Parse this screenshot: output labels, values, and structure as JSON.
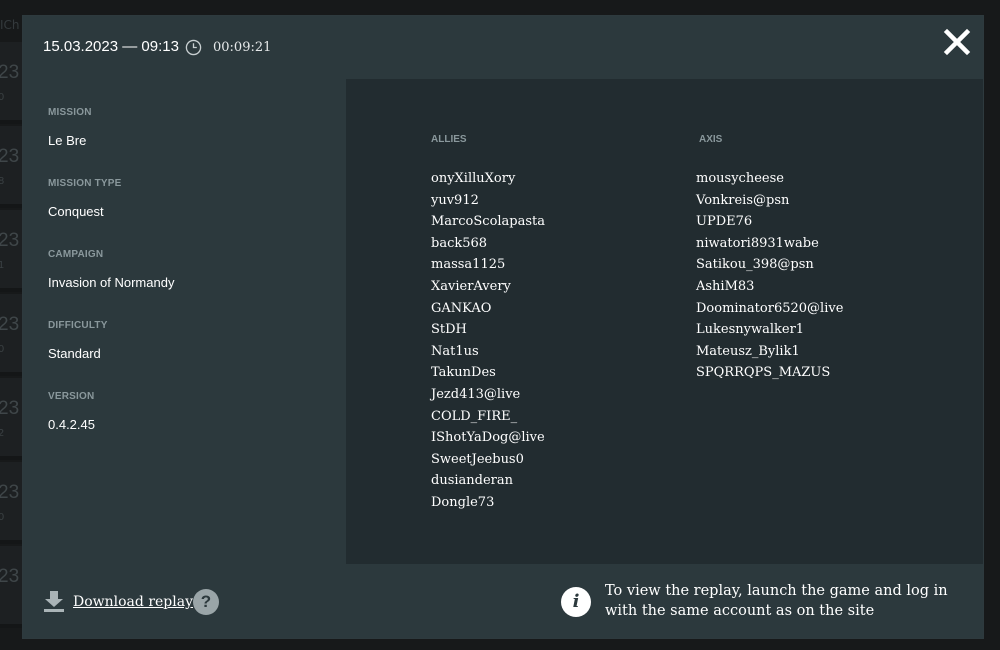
{
  "header": {
    "datetime": "15.03.2023 — 09:13",
    "duration": "00:09:21"
  },
  "details": {
    "mission_label": "MISSION",
    "mission_value": "Le Bre",
    "mission_type_label": "MISSION TYPE",
    "mission_type_value": "Conquest",
    "campaign_label": "CAMPAIGN",
    "campaign_value": "Invasion of Normandy",
    "difficulty_label": "DIFFICULTY",
    "difficulty_value": "Standard",
    "version_label": "VERSION",
    "version_value": "0.4.2.45"
  },
  "allies": {
    "title": "ALLIES",
    "players": [
      "onyXilluXory",
      "yuv912",
      "MarcoScolapasta",
      "back568",
      "massa1125",
      "XavierAvery",
      "GANKAO",
      "StDH",
      "Nat1us",
      "TakunDes",
      "Jezd413@live",
      "COLD_FIRE_",
      "IShotYaDog@live",
      "SweetJeebus0",
      "dusianderan",
      "Dongle73"
    ]
  },
  "axis": {
    "title": "AXIS",
    "players": [
      "mousycheese",
      "Vonkreis@psn",
      "UPDE76",
      "niwatori8931wabe",
      "Satikou_398@psn",
      "AshiM83",
      "Doominator6520@live",
      "Lukesnywalker1",
      "Mateusz_Bylik1",
      "SPQRRQPS_MAZUS"
    ]
  },
  "footer": {
    "download_label": "Download replay",
    "help_symbol": "?",
    "info_symbol": "i",
    "info_text": "To view the replay, launch the game and log in with the same account as on the site"
  },
  "background": {
    "top_fragment": "ICh",
    "rows": [
      {
        "num": "23",
        "sub": "0"
      },
      {
        "num": "23",
        "sub": "8"
      },
      {
        "num": "23",
        "sub": "1"
      },
      {
        "num": "23",
        "sub": "0"
      },
      {
        "num": "23",
        "sub": "2"
      },
      {
        "num": "23",
        "sub": "0"
      },
      {
        "num": "23",
        "sub": ""
      }
    ]
  },
  "icons": {
    "clock": "clock-icon",
    "close": "close-icon",
    "download": "download-icon",
    "help": "help-icon",
    "info": "info-icon"
  },
  "colors": {
    "page_bg": "#17191a",
    "panel": "#2c393d",
    "panel_dark": "#222c30",
    "label": "#8a989c",
    "text": "#ffffff"
  }
}
